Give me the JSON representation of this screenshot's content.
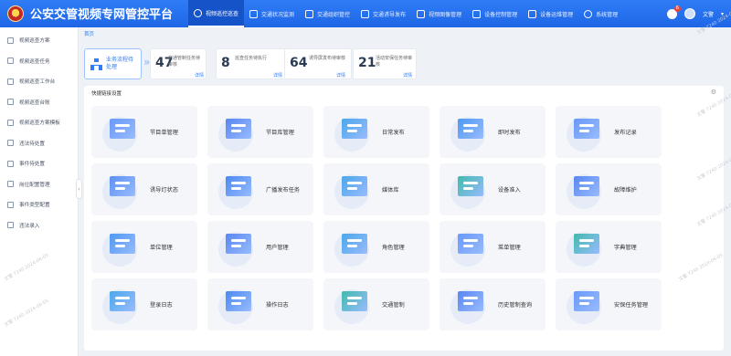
{
  "app": {
    "title": "公安交管视频专网管控平台"
  },
  "nav": [
    {
      "label": "视频巡控巡查",
      "active": true
    },
    {
      "label": "交通状况监测"
    },
    {
      "label": "交通组织管控"
    },
    {
      "label": "交通诱导发布"
    },
    {
      "label": "视频图像管理"
    },
    {
      "label": "设备控制管理"
    },
    {
      "label": "设备运维管理"
    },
    {
      "label": "系统管理"
    }
  ],
  "user": {
    "name": "文警",
    "badge": "6"
  },
  "sidebar": [
    {
      "label": "视频巡查方案"
    },
    {
      "label": "视频巡查任务"
    },
    {
      "label": "视频巡查工作台"
    },
    {
      "label": "视频巡查台账"
    },
    {
      "label": "视频巡查方案模板"
    },
    {
      "label": "违法待处置"
    },
    {
      "label": "事件待处置"
    },
    {
      "label": "岗位配置管理"
    },
    {
      "label": "事件类型配置"
    },
    {
      "label": "违法录入"
    }
  ],
  "breadcrumb": "首页",
  "stats": {
    "main_label": "业务流程待处理",
    "items": [
      {
        "value": "47",
        "label": "交通管制任务待审核",
        "link": "详情"
      },
      {
        "value": "8",
        "label": "巡查任务待执行",
        "link": "详情"
      },
      {
        "value": "64",
        "label": "诱导屏发布待审核",
        "link": "详情"
      },
      {
        "value": "21",
        "label": "活动安保任务待审核",
        "link": "详情"
      }
    ]
  },
  "quick_panel": {
    "title": "快捷链接设置",
    "tiles": [
      {
        "label": "节目单管理",
        "icon": "program-list-icon",
        "color": "#5b8ff9"
      },
      {
        "label": "节目库管理",
        "icon": "program-library-icon",
        "color": "#4a7bf0"
      },
      {
        "label": "日常发布",
        "icon": "daily-publish-icon",
        "color": "#3aa0e8"
      },
      {
        "label": "即时发布",
        "icon": "instant-publish-icon",
        "color": "#3f8ff0"
      },
      {
        "label": "发布记录",
        "icon": "publish-record-icon",
        "color": "#5b8ff9"
      },
      {
        "label": "诱导灯状态",
        "icon": "guide-light-icon",
        "color": "#4f86f2"
      },
      {
        "label": "广播发布任务",
        "icon": "broadcast-icon",
        "color": "#3c7ef0"
      },
      {
        "label": "媒体库",
        "icon": "media-library-icon",
        "color": "#3aa0e8"
      },
      {
        "label": "设备准入",
        "icon": "device-access-icon",
        "color": "#2fb5a5"
      },
      {
        "label": "故障维护",
        "icon": "fault-maintenance-icon",
        "color": "#4a7bf0"
      },
      {
        "label": "单位管理",
        "icon": "unit-icon",
        "color": "#3f8ff0"
      },
      {
        "label": "用户管理",
        "icon": "user-icon",
        "color": "#4a7bf0"
      },
      {
        "label": "角色管理",
        "icon": "role-icon",
        "color": "#3aa0e8"
      },
      {
        "label": "菜单管理",
        "icon": "menu-icon",
        "color": "#5b8ff9"
      },
      {
        "label": "字典管理",
        "icon": "dictionary-icon",
        "color": "#2fb5a5"
      },
      {
        "label": "登录日志",
        "icon": "login-log-icon",
        "color": "#3aa0e8"
      },
      {
        "label": "操作日志",
        "icon": "operation-log-icon",
        "color": "#3c7ef0"
      },
      {
        "label": "交通管制",
        "icon": "traffic-control-icon",
        "color": "#2fb5a5"
      },
      {
        "label": "历史管制查询",
        "icon": "history-query-icon",
        "color": "#4a7bf0"
      },
      {
        "label": "安保任务管理",
        "icon": "security-task-icon",
        "color": "#5b8ff9"
      }
    ]
  },
  "watermark": "文警 7240 2024-06-05"
}
